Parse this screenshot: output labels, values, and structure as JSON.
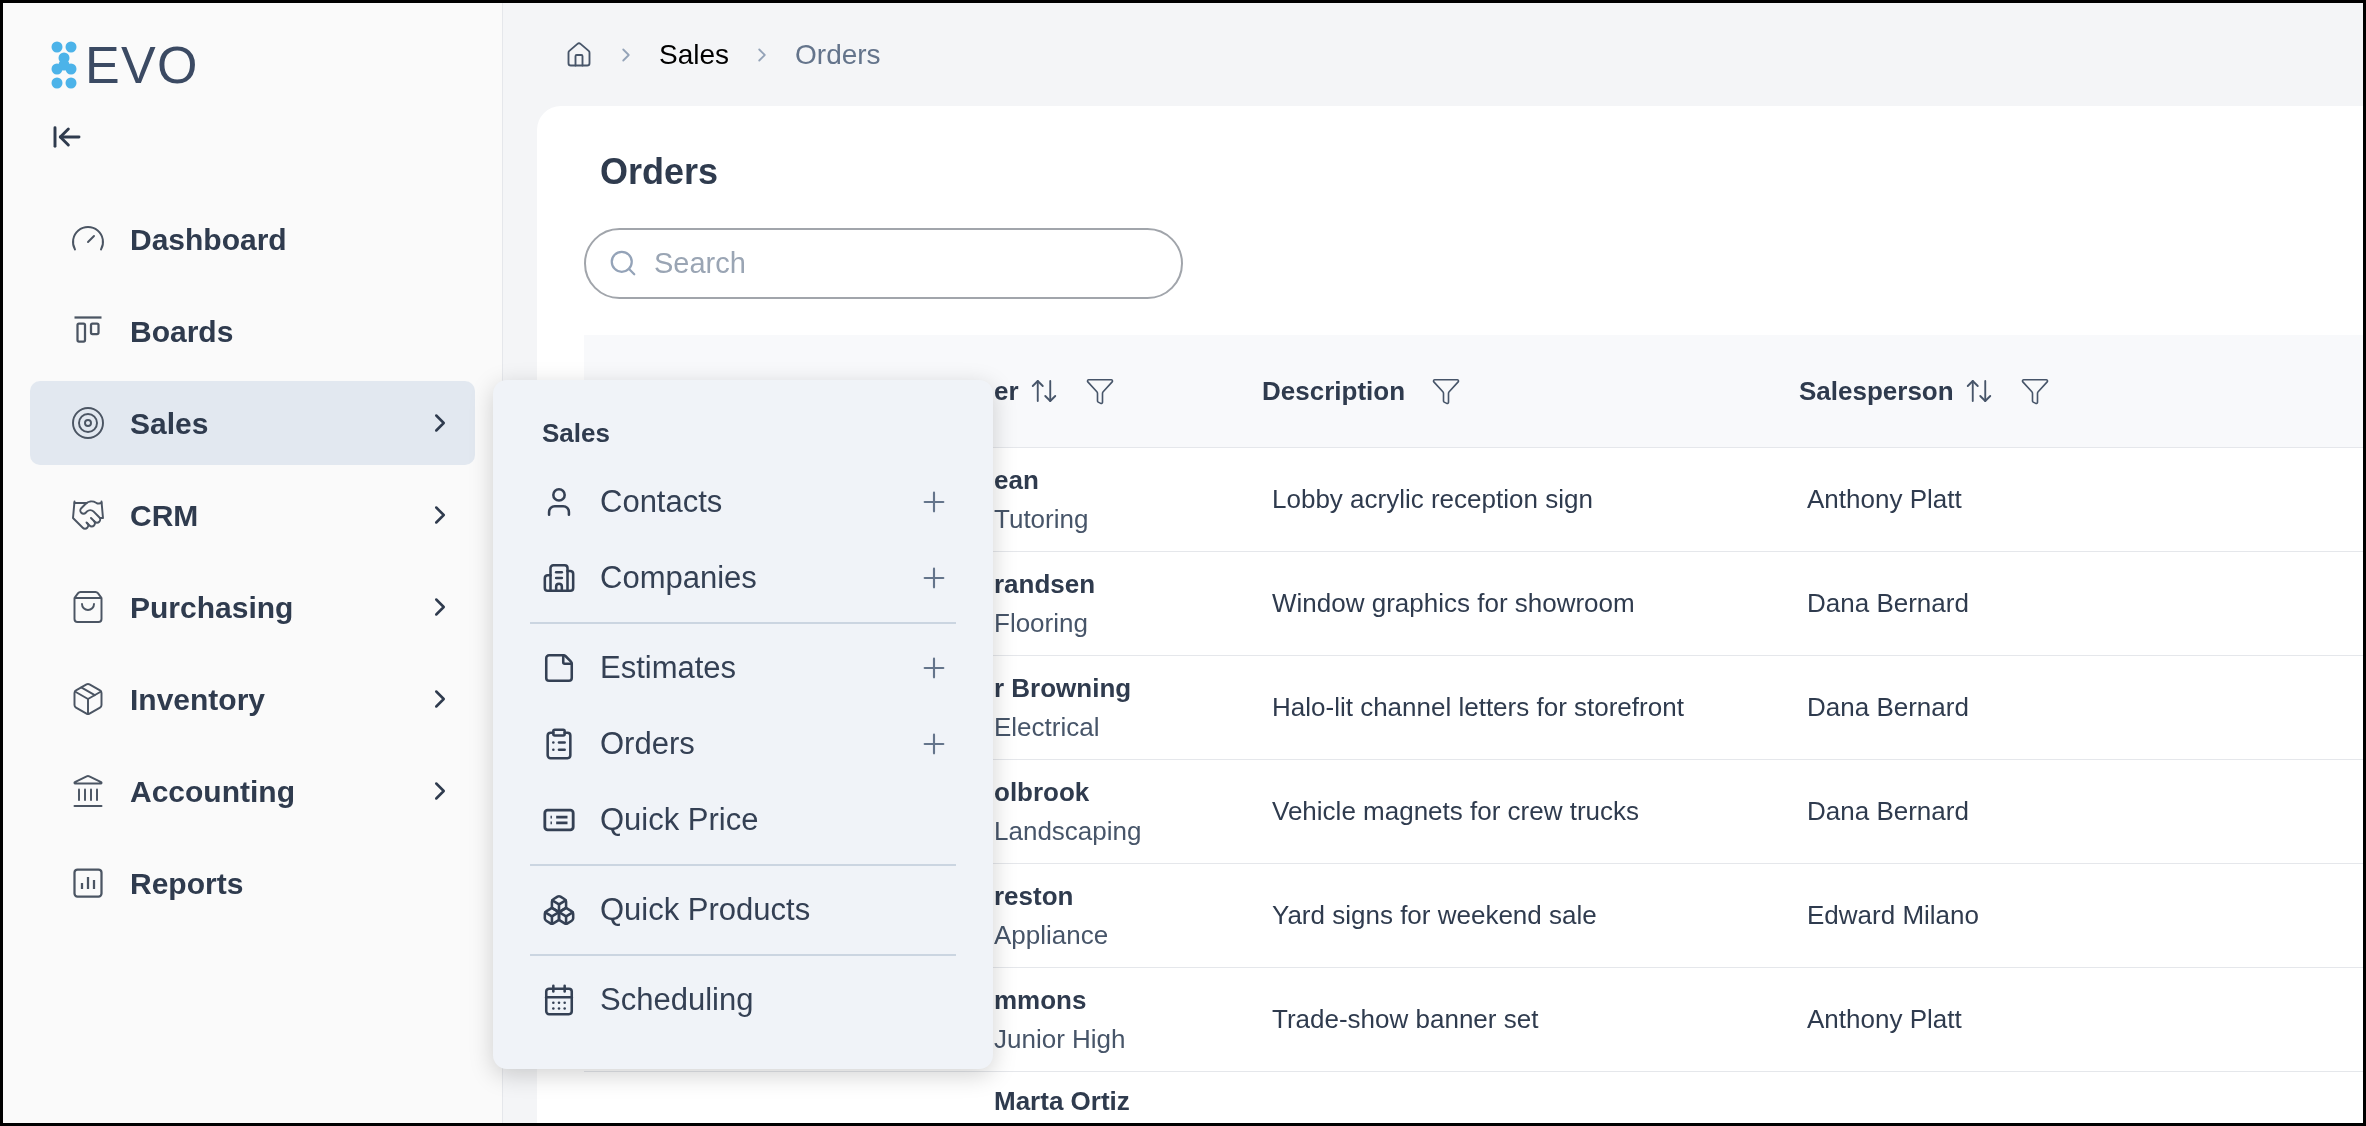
{
  "logo": {
    "text": "EVO"
  },
  "sidebar": {
    "items": [
      {
        "label": "Dashboard",
        "has_submenu": false,
        "selected": false
      },
      {
        "label": "Boards",
        "has_submenu": false,
        "selected": false
      },
      {
        "label": "Sales",
        "has_submenu": true,
        "selected": true
      },
      {
        "label": "CRM",
        "has_submenu": true,
        "selected": false
      },
      {
        "label": "Purchasing",
        "has_submenu": true,
        "selected": false
      },
      {
        "label": "Inventory",
        "has_submenu": true,
        "selected": false
      },
      {
        "label": "Accounting",
        "has_submenu": true,
        "selected": false
      },
      {
        "label": "Reports",
        "has_submenu": false,
        "selected": false
      }
    ]
  },
  "breadcrumb": [
    {
      "label": "Sales",
      "current": false
    },
    {
      "label": "Orders",
      "current": true
    }
  ],
  "page_title": "Orders",
  "search": {
    "placeholder": "Search"
  },
  "table": {
    "columns": [
      {
        "label": "er",
        "sortable": true,
        "filterable": true
      },
      {
        "label": "Description",
        "sortable": false,
        "filterable": true
      },
      {
        "label": "Salesperson",
        "sortable": true,
        "filterable": true
      }
    ],
    "rows": [
      {
        "customer": "ean",
        "company": "Tutoring",
        "description": "Lobby acrylic reception sign",
        "salesperson": "Anthony Platt"
      },
      {
        "customer": "randsen",
        "company": "Flooring",
        "description": "Window graphics for showroom",
        "salesperson": "Dana Bernard"
      },
      {
        "customer": "r Browning",
        "company": "Electrical",
        "description": "Halo-lit channel letters for storefront",
        "salesperson": "Dana Bernard"
      },
      {
        "customer": "olbrook",
        "company": "Landscaping",
        "description": "Vehicle magnets for crew trucks",
        "salesperson": "Dana Bernard"
      },
      {
        "customer": "reston",
        "company": "Appliance",
        "description": "Yard signs for weekend sale",
        "salesperson": "Edward Milano"
      },
      {
        "customer": "mmons",
        "company": "Junior High",
        "description": "Trade-show banner set",
        "salesperson": "Anthony Platt"
      },
      {
        "customer": "Marta Ortiz"
      }
    ]
  },
  "flyout": {
    "title": "Sales",
    "groups": [
      [
        {
          "label": "Contacts",
          "add_button": true
        },
        {
          "label": "Companies",
          "add_button": true
        }
      ],
      [
        {
          "label": "Estimates",
          "add_button": true
        },
        {
          "label": "Orders",
          "add_button": true
        },
        {
          "label": "Quick Price",
          "add_button": false
        }
      ],
      [
        {
          "label": "Quick Products",
          "add_button": false
        }
      ],
      [
        {
          "label": "Scheduling",
          "add_button": false
        }
      ]
    ]
  }
}
